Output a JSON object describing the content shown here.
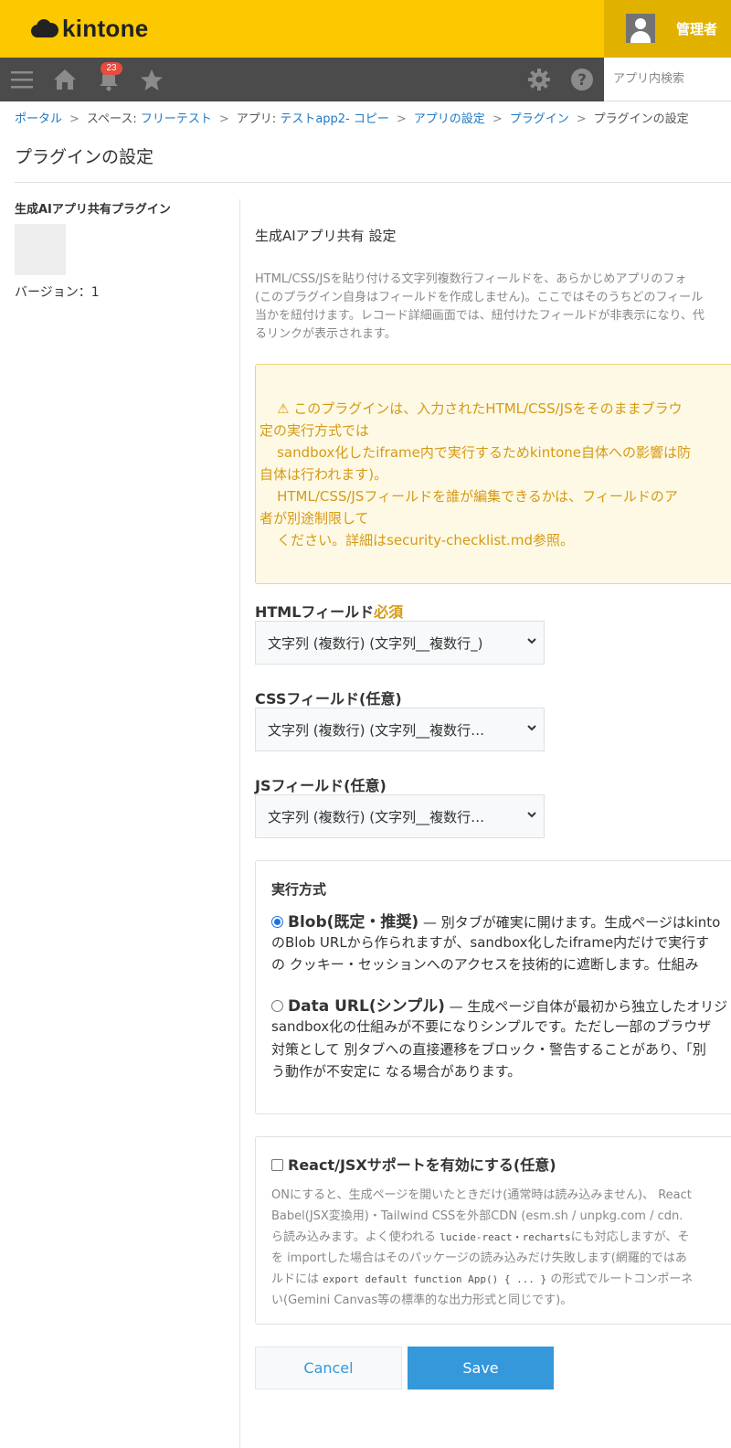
{
  "header": {
    "logo_text": "kintone",
    "user_name": "管理者",
    "notification_count": "23",
    "search_placeholder": "アプリ内検索"
  },
  "nav": {
    "icons": [
      "menu-icon",
      "home-icon",
      "bell-icon",
      "star-icon",
      "gear-icon",
      "help-icon"
    ]
  },
  "breadcrumb": {
    "portal": "ポータル",
    "space_prefix": "スペース: ",
    "space": "フリーテスト",
    "app_prefix": "アプリ: ",
    "app": "テストapp2- コピー",
    "app_settings": "アプリの設定",
    "plugins": "プラグイン",
    "current": "プラグインの設定",
    "separator": ">"
  },
  "page_title": "プラグインの設定",
  "plugin": {
    "name": "生成AIアプリ共有プラグイン",
    "version": "バージョン：1"
  },
  "settings": {
    "title": "生成AIアプリ共有 設定",
    "description": [
      "HTML/CSS/JSを貼り付ける文字列複数行フィールドを、あらかじめアプリのフォ",
      "(このプラグイン自身はフィールドを作成しません)。ここではそのうちどのフィール",
      "当かを紐付けます。レコード詳細画面では、紐付けたフィールドが非表示になり、代",
      "るリンクが表示されます。"
    ],
    "warning": [
      "    ⚠ このプラグインは、入力されたHTML/CSS/JSをそのままブラウ",
      "定の実行方式では",
      "    sandbox化したiframe内で実行するためkintone自体への影響は防",
      "自体は行われます)。",
      "    HTML/CSS/JSフィールドを誰が編集できるかは、フィールドのア",
      "者が別途制限して",
      "    ください。詳細はsecurity-checklist.md参照。"
    ],
    "html_field": {
      "label": "HTMLフィールド",
      "required": "必須",
      "value": "文字列 (複数行) (文字列__複数行_)"
    },
    "css_field": {
      "label": "CSSフィールド(任意)",
      "value": "文字列 (複数行) (文字列__複数行…"
    },
    "js_field": {
      "label": "JSフィールド(任意)",
      "value": "文字列 (複数行) (文字列__複数行…"
    },
    "exec_mode": {
      "title": "実行方式",
      "blob": {
        "label": "Blob(既定・推奨)",
        "checked": true,
        "lines": [
          " — 別タブが確実に開けます。生成ページはkinto",
          "のBlob URLから作られますが、sandbox化したiframe内だけで実行す",
          "の クッキー・セッションへのアクセスを技術的に遮断します。仕組み"
        ]
      },
      "dataurl": {
        "label": "Data URL(シンプル)",
        "checked": false,
        "lines": [
          " — 生成ページ自体が最初から独立したオリジ",
          "sandbox化の仕組みが不要になりシンプルです。ただし一部のブラウザ",
          "対策として 別タブへの直接遷移をブロック・警告することがあり、「別",
          "う動作が不安定に なる場合があります。"
        ]
      }
    },
    "react": {
      "label": "React/JSXサポートを有効にする(任意)",
      "checked": false,
      "line1": "ONにすると、生成ページを開いたときだけ(通常時は読み込みません)、 React",
      "line2": "Babel(JSX変換用)・Tailwind CSSを外部CDN (esm.sh / unpkg.com / cdn.",
      "line3_a": "ら読み込みます。よく使われる ",
      "line3_code": "lucide-react・recharts",
      "line3_b": "にも対応しますが、そ",
      "line4": "を importした場合はそのパッケージの読み込みだけ失敗します(網羅的ではあ",
      "line5_a": "ルドには ",
      "line5_code": "export default function App() { ... }",
      "line5_b": " の形式でルートコンポーネ",
      "line6": "い(Gemini Canvas等の標準的な出力形式と同じです)。"
    }
  },
  "buttons": {
    "cancel": "Cancel",
    "save": "Save"
  }
}
